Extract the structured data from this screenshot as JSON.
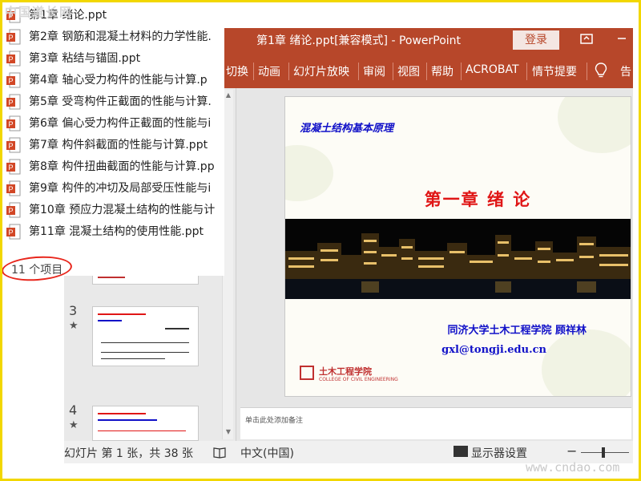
{
  "watermarks": {
    "top": "中国道长网",
    "bottom": "www.cndao.com"
  },
  "file_list": {
    "items": [
      {
        "name": "第1章 绪论.ppt",
        "icon": "pptx-file-icon"
      },
      {
        "name": "第2章  钢筋和混凝土材料的力学性能.",
        "icon": "pptx-file-icon"
      },
      {
        "name": "第3章  粘结与锚固.ppt",
        "icon": "pptx-file-icon"
      },
      {
        "name": "第4章  轴心受力构件的性能与计算.p",
        "icon": "pptx-file-icon"
      },
      {
        "name": "第5章  受弯构件正截面的性能与计算.",
        "icon": "pptx-file-icon"
      },
      {
        "name": "第6章  偏心受力构件正截面的性能与i",
        "icon": "pptx-file-icon"
      },
      {
        "name": "第7章  构件斜截面的性能与计算.ppt",
        "icon": "pptx-file-icon"
      },
      {
        "name": "第8章  构件扭曲截面的性能与计算.pp",
        "icon": "pptx-file-icon"
      },
      {
        "name": "第9章  构件的冲切及局部受压性能与i",
        "icon": "pptx-file-icon"
      },
      {
        "name": "第10章  预应力混凝土结构的性能与计",
        "icon": "pptx-file-icon"
      },
      {
        "name": "第11章  混凝土结构的使用性能.ppt",
        "icon": "pptx-file-icon"
      }
    ],
    "count_text": "11 个项目",
    "highlight_color": "#e8261c"
  },
  "powerpoint": {
    "title": "第1章 绪论.ppt[兼容模式]  -  PowerPoint",
    "login_label": "登录",
    "window_button_icon": "restore-window-icon",
    "accent_color": "#b7472a",
    "ribbon_tabs": [
      "切换",
      "动画",
      "幻灯片放映",
      "审阅",
      "视图",
      "帮助",
      "ACROBAT",
      "情节提要"
    ],
    "tell_me_icon": "lightbulb-icon",
    "tell_me_label": "告",
    "thumbnails": [
      {
        "number": "3",
        "star": "★"
      },
      {
        "number": "4",
        "star": "★"
      }
    ],
    "slide": {
      "header": "混凝土结构基本原理",
      "chapter": "第一章  绪  论",
      "school": "同济大学土木工程学院  顾祥林",
      "email": "gxl@tongji.edu.cn",
      "logo_text": "土木工程学院",
      "logo_subtext": "COLLEGE OF CIVIL ENGINEERING",
      "header_color": "#1010c8",
      "chapter_color": "#e01616"
    },
    "notes_placeholder": "单击此处添加备注",
    "status": {
      "slide_info": "幻灯片 第 1 张，共 38 张",
      "language": "中文(中国)",
      "display_settings": "显示器设置",
      "zoom_minus": "−"
    }
  }
}
